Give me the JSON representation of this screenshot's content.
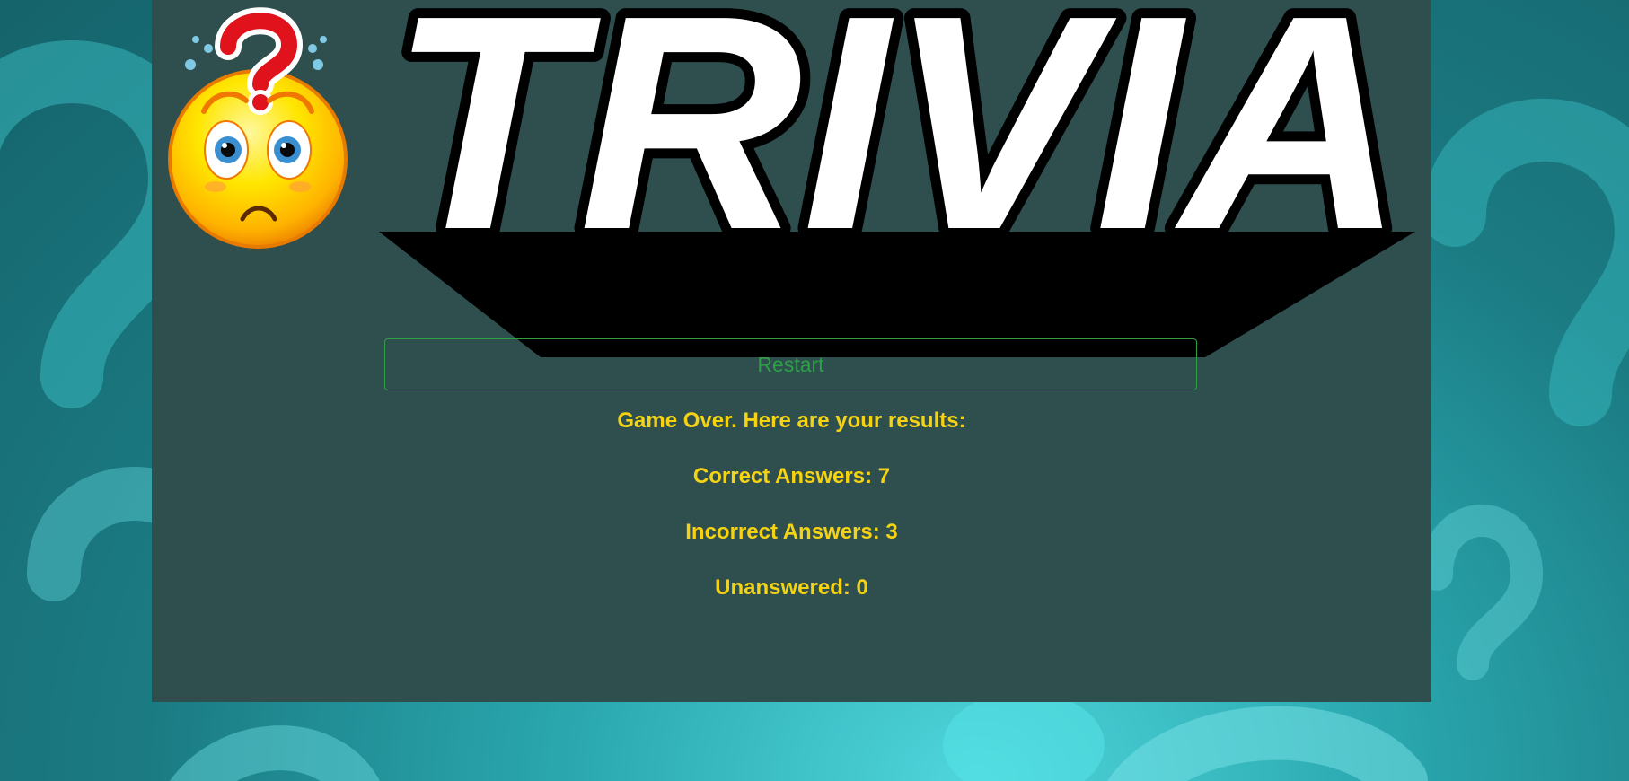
{
  "logo": {
    "text": "TRIVIA"
  },
  "restart_button": {
    "label": "Restart"
  },
  "results": {
    "heading": "Game Over. Here are your results:",
    "correct": "Correct Answers: 7",
    "incorrect": "Incorrect Answers: 3",
    "unanswered": "Unanswered: 0"
  },
  "colors": {
    "panel": "#2f4f4f",
    "results_text": "#f5d312",
    "restart_accent": "#2e9e47"
  },
  "icons": {
    "mascot": "confused-face-question-icon",
    "background": "question-mark-pattern"
  }
}
